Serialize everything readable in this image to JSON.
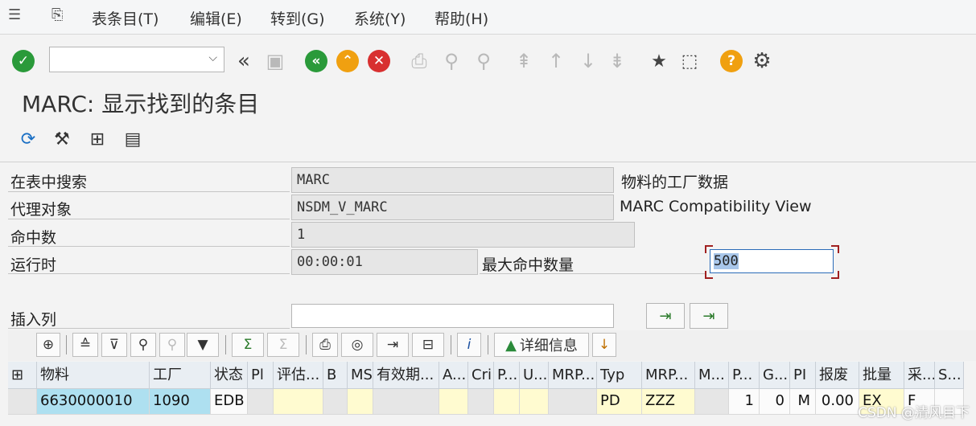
{
  "menu": [
    "表条目(T)",
    "编辑(E)",
    "转到(G)",
    "系统(Y)",
    "帮助(H)"
  ],
  "page_title": "MARC: 显示找到的条目",
  "fields": {
    "search_table_label": "在表中搜索",
    "search_table_value": "MARC",
    "search_table_desc": "物料的工厂数据",
    "proxy_label": "代理对象",
    "proxy_value": "NSDM_V_MARC",
    "proxy_desc": "MARC Compatibility View",
    "hits_label": "命中数",
    "hits_value": "1",
    "runtime_label": "运行时",
    "runtime_value": "00:00:01",
    "maxhits_label": "最大命中数量",
    "maxhits_value": "500",
    "insert_col_label": "插入列"
  },
  "alv": {
    "detail_label": "详细信息"
  },
  "table": {
    "headers": [
      "物料",
      "工厂",
      "状态",
      "Pl",
      "评估...",
      "B",
      "MS",
      "有效期...",
      "A...",
      "Cri",
      "P...",
      "U...",
      "MRP...",
      "Typ",
      "MRP...",
      "M...",
      "P...",
      "G...",
      "PI",
      "报废",
      "批量",
      "采...",
      "S..."
    ],
    "row": [
      "6630000010",
      "1090",
      "EDB",
      "",
      "",
      "",
      "",
      "",
      "",
      "",
      "",
      "",
      "",
      "PD",
      "ZZZ",
      "",
      "1",
      "0",
      "M",
      "0.00",
      "EX",
      "F",
      ""
    ]
  },
  "watermark": "CSDN @清风目下",
  "icons": [
    "menu-icon",
    "layout-icon",
    "enter-icon",
    "command-dropdown-icon",
    "double-left-icon",
    "save-icon",
    "back-icon",
    "exit-icon",
    "cancel-icon",
    "print-icon",
    "find-icon",
    "find-next-icon",
    "first-page-icon",
    "prev-page-icon",
    "next-page-icon",
    "last-page-icon",
    "create-session-icon",
    "shortcut-icon",
    "help-icon",
    "settings-icon"
  ]
}
